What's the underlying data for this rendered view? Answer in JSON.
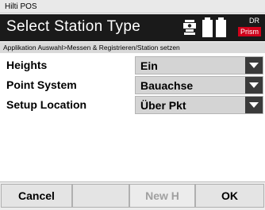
{
  "window": {
    "title": "Hilti POS"
  },
  "header": {
    "title": "Select Station Type",
    "status": {
      "top": "DR",
      "bottom": "Prism"
    },
    "colors": {
      "prism_bg": "#d0021b"
    }
  },
  "breadcrumb": "Applikation Auswahl>Messen & Registrieren/Station setzen",
  "fields": [
    {
      "label": "Heights",
      "value": "Ein"
    },
    {
      "label": "Point System",
      "value": "Bauachse"
    },
    {
      "label": "Setup Location",
      "value": "Über Pkt"
    }
  ],
  "softkeys": {
    "cancel": "Cancel",
    "blank": "",
    "new_h": "New H",
    "ok": "OK"
  }
}
